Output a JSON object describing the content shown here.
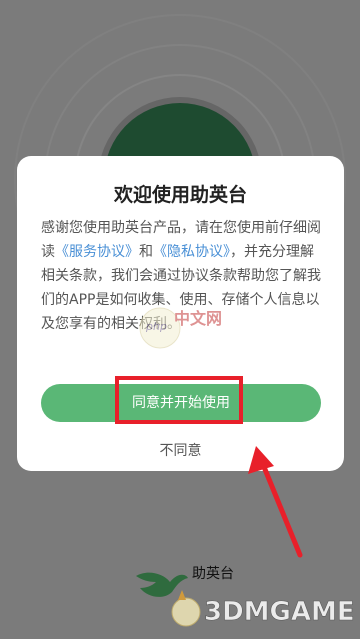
{
  "dialog": {
    "title": "欢迎使用助英台",
    "body_prefix": "感谢您使用助英台产品，请在您使用前仔细阅读",
    "service_link": "《服务协议》",
    "and": "和",
    "privacy_link": "《隐私协议》",
    "body_suffix": "，并充分理解相关条款，我们会通过协议条款帮助您了解我们的APP是如何收集、使用、存储个人信息以及您享有的相关权利。",
    "agree_label": "同意并开始使用",
    "disagree_label": "不同意"
  },
  "app": {
    "name": "助英台"
  },
  "watermarks": {
    "php": "php 中文网",
    "brand": "3DMGAME"
  },
  "colors": {
    "overlay": "#7b7b7b",
    "accent_green": "#5ab776",
    "link_blue": "#4a90d6",
    "highlight_red": "#e8202a",
    "logo_dark_green": "#1e4b30"
  }
}
